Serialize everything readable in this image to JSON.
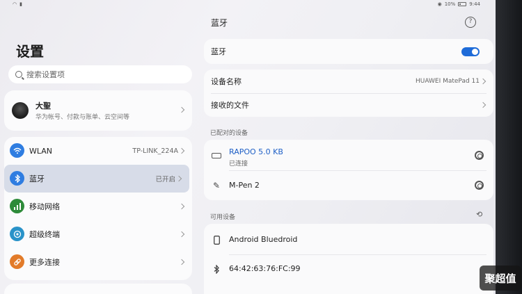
{
  "status": {
    "battery": "10%",
    "time": "9:44"
  },
  "left": {
    "title": "设置",
    "search_placeholder": "搜索设置项",
    "account": {
      "name": "大聖",
      "desc": "华为帐号、付款与账单、云空间等"
    },
    "nav": [
      {
        "label": "WLAN",
        "value": "TP-LINK_224A",
        "icon": "wifi-icon",
        "color": "#2f7de1"
      },
      {
        "label": "蓝牙",
        "value": "已开启",
        "icon": "bluetooth-icon",
        "color": "#2f7de1"
      },
      {
        "label": "移动网络",
        "value": "",
        "icon": "mobile-network-icon",
        "color": "#2e8b3a"
      },
      {
        "label": "超级终端",
        "value": "",
        "icon": "super-device-icon",
        "color": "#2a93c9"
      },
      {
        "label": "更多连接",
        "value": "",
        "icon": "link-icon",
        "color": "#e27b2a"
      }
    ]
  },
  "right": {
    "title": "蓝牙",
    "bluetooth_label": "蓝牙",
    "device_name_label": "设备名称",
    "device_name_value": "HUAWEI MatePad 11",
    "received_files_label": "接收的文件",
    "paired_header": "已配对的设备",
    "paired": [
      {
        "name": "RAPOO 5.0 KB",
        "status": "已连接",
        "icon": "keyboard-icon"
      },
      {
        "name": "M-Pen 2",
        "status": "",
        "icon": "pen-icon"
      }
    ],
    "available_header": "可用设备",
    "available": [
      {
        "name": "Android Bluedroid",
        "icon": "phone-icon"
      },
      {
        "name": "64:42:63:76:FC:99",
        "icon": "bluetooth-icon"
      }
    ]
  },
  "watermark": "聚超值"
}
